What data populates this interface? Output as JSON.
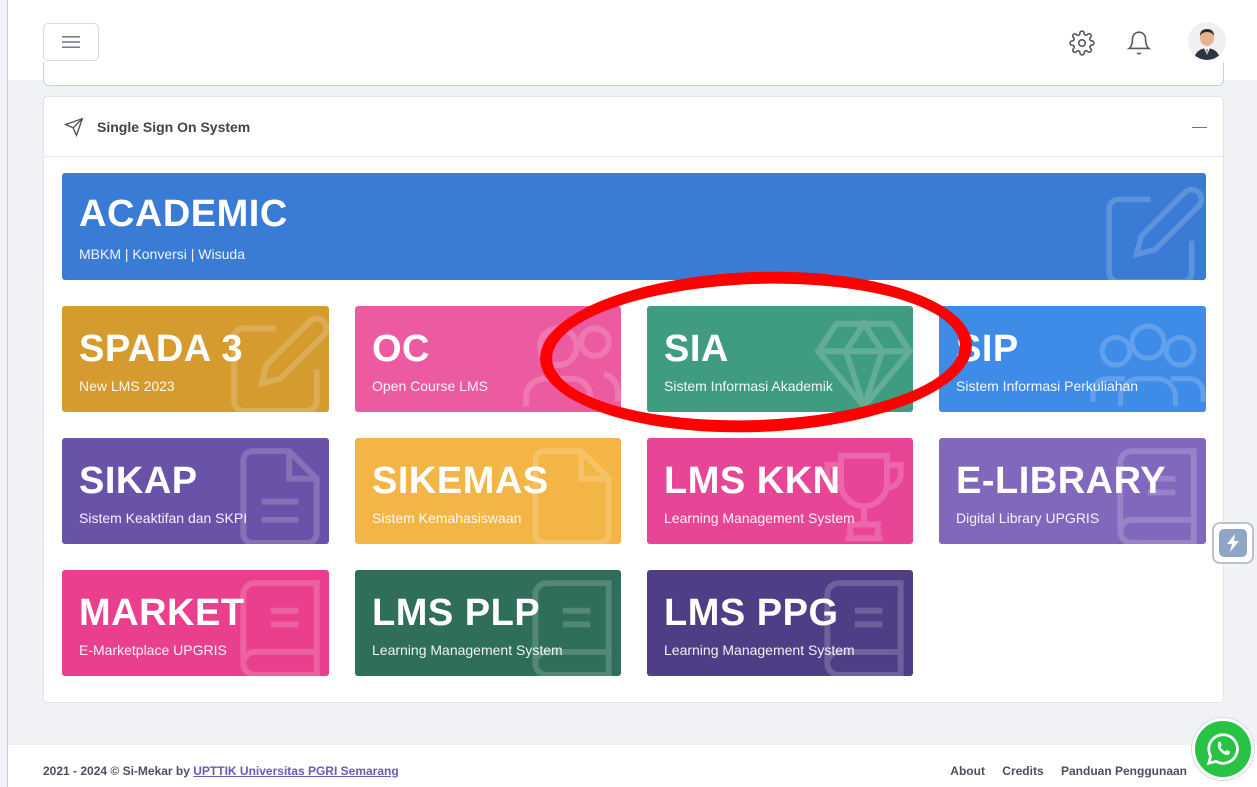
{
  "header": {
    "menu_icon": "hamburger-icon",
    "settings_icon": "gear-icon",
    "notification_icon": "bell-icon",
    "avatar_icon": "user-avatar"
  },
  "panel": {
    "title": "Single Sign On System",
    "title_icon": "send-icon",
    "collapse_icon": "minus-icon"
  },
  "tiles": [
    {
      "title": "ACADEMIC",
      "subtitle": "MBKM | Konversi | Wisuda",
      "color": "#3a7bd5",
      "icon": "edit-icon"
    },
    {
      "title": "SPADA 3",
      "subtitle": "New LMS 2023",
      "color": "#d59b2f",
      "icon": "edit-icon"
    },
    {
      "title": "OC",
      "subtitle": "Open Course LMS",
      "color": "#ec5ba0",
      "icon": "users-icon"
    },
    {
      "title": "SIA",
      "subtitle": "Sistem Informasi Akademik",
      "color": "#3f9c80",
      "icon": "diamond-icon"
    },
    {
      "title": "SIP",
      "subtitle": "Sistem Informasi Perkuliahan",
      "color": "#3f8be8",
      "icon": "users-icon"
    },
    {
      "title": "SIKAP",
      "subtitle": "Sistem Keaktifan dan SKPI",
      "color": "#6a52a8",
      "icon": "document-icon"
    },
    {
      "title": "SIKEMAS",
      "subtitle": "Sistem Kemahasiswaan",
      "color": "#f3b545",
      "icon": "document-icon"
    },
    {
      "title": "LMS KKN",
      "subtitle": "Learning Management System",
      "color": "#e84597",
      "icon": "trophy-icon"
    },
    {
      "title": "E-LIBRARY",
      "subtitle": "Digital Library UPGRIS",
      "color": "#8168bd",
      "icon": "book-icon"
    },
    {
      "title": "MARKET",
      "subtitle": "E-Marketplace UPGRIS",
      "color": "#e93f8d",
      "icon": "book-icon"
    },
    {
      "title": "LMS PLP",
      "subtitle": "Learning Management System",
      "color": "#2e6e5b",
      "icon": "book-icon"
    },
    {
      "title": "LMS PPG",
      "subtitle": "Learning Management System",
      "color": "#4f3e86",
      "icon": "book-icon"
    }
  ],
  "footer": {
    "copyright_prefix": "2021 - 2024 © Si-Mekar by ",
    "copyright_link": "UPTTIK Universitas PGRI Semarang",
    "links": [
      "About",
      "Credits",
      "Panduan Penggunaan"
    ]
  },
  "floating": {
    "side_button_icon": "lightning-icon",
    "whatsapp_icon": "whatsapp-icon"
  }
}
